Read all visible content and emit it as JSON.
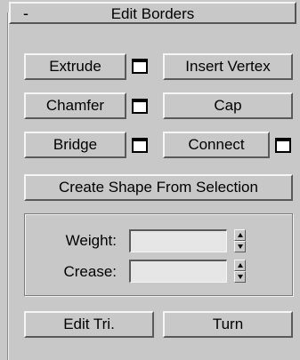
{
  "rollout": {
    "title": "Edit Borders",
    "collapse_symbol": "-"
  },
  "buttons": {
    "extrude": "Extrude",
    "insert_vertex": "Insert Vertex",
    "chamfer": "Chamfer",
    "cap": "Cap",
    "bridge": "Bridge",
    "connect": "Connect",
    "create_shape": "Create Shape From Selection",
    "edit_tri": "Edit Tri.",
    "turn": "Turn"
  },
  "fields": {
    "weight_label": "Weight:",
    "weight_value": "",
    "crease_label": "Crease:",
    "crease_value": ""
  },
  "icons": {
    "settings_box": "settings-box-icon",
    "spinner": "spinner-icon"
  },
  "colors": {
    "panel_bg": "#c8c8c8",
    "field_bg": "#e6e6e6"
  }
}
